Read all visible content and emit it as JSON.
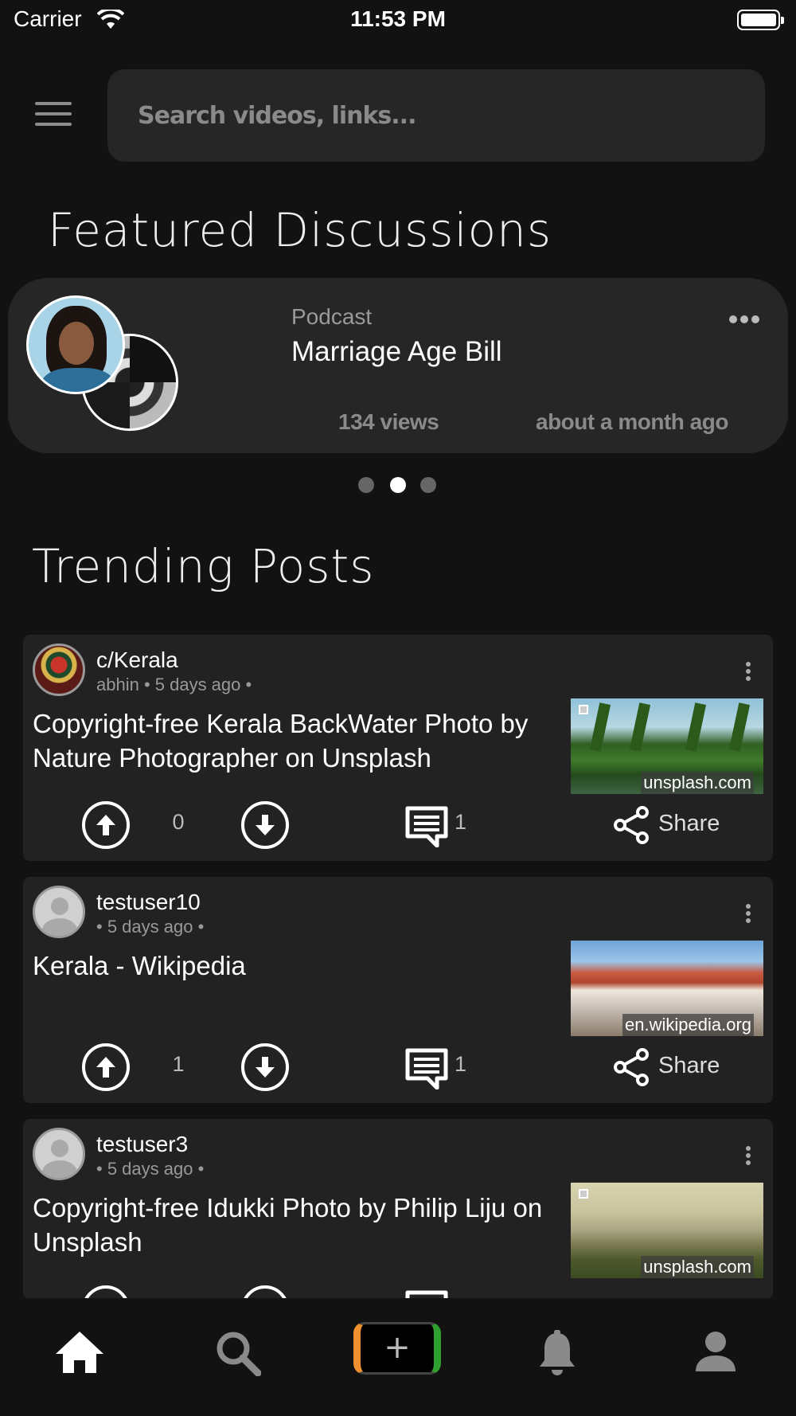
{
  "status_bar": {
    "carrier": "Carrier",
    "time": "11:53 PM"
  },
  "search": {
    "placeholder": "Search videos, links..."
  },
  "featured": {
    "section_title": "Featured Discussions",
    "card": {
      "category": "Podcast",
      "title": "Marriage Age Bill",
      "views": "134 views",
      "time": "about a month ago"
    },
    "carousel": {
      "count": 3,
      "active_index": 1
    }
  },
  "trending": {
    "section_title": "Trending Posts",
    "posts": [
      {
        "community": "c/Kerala",
        "meta": "abhin • 5 days ago •",
        "title": "Copyright-free Kerala BackWater Photo by Nature Photographer on Unsplash",
        "thumb_domain": "unsplash.com",
        "votes": "0",
        "comments": "1",
        "share_label": "Share"
      },
      {
        "community": "testuser10",
        "meta": "• 5 days ago •",
        "title": "Kerala - Wikipedia",
        "thumb_domain": "en.wikipedia.org",
        "votes": "1",
        "comments": "1",
        "share_label": "Share"
      },
      {
        "community": "testuser3",
        "meta": "• 5 days ago •",
        "title": "Copyright-free Idukki Photo by Philip Liju on Unsplash",
        "thumb_domain": "unsplash.com",
        "votes": "",
        "comments": "",
        "share_label": ""
      }
    ]
  },
  "bottom_nav": {
    "items": [
      "home-icon",
      "search-icon",
      "create-icon",
      "bell-icon",
      "profile-icon"
    ],
    "active": "home-icon"
  },
  "colors": {
    "background": "#121212",
    "card": "#262626",
    "create_left": "#f0902e",
    "create_right": "#2fa02f"
  }
}
